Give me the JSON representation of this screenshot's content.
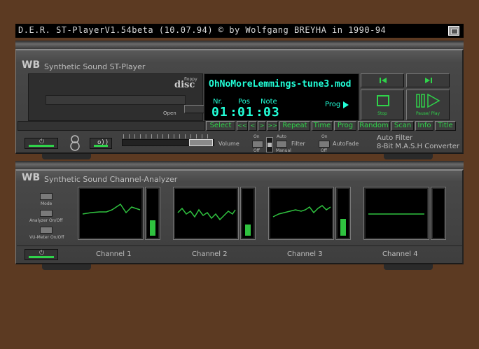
{
  "window": {
    "title": "D.E.R. ST-PlayerV1.54beta (10.07.94)  © by Wolfgang BREYHA in 1990-94"
  },
  "player": {
    "brand": "WB",
    "heading": "Synthetic Sound ST-Player",
    "floppy_label": "floppy",
    "disc_label": "disc",
    "open_label": "Open",
    "display": {
      "module_name": "OhNoMoreLemmings-tune3.mod",
      "nr_label": "Nr.",
      "pos_label": "Pos",
      "note_label": "Note",
      "nr_value": "01",
      "pos_value": "01",
      "note_value": "03",
      "mode_label": "Prog"
    },
    "transport": {
      "stop_label": "Stop",
      "pause_play_label": "Pause/ Play"
    },
    "function_buttons": [
      "Select",
      "<<",
      "<",
      ">",
      ">>",
      "Repeat",
      "Time",
      "Prog",
      "Random",
      "Scan",
      "Info",
      "Title"
    ],
    "controls": {
      "volume_label": "Volume",
      "on_label": "On",
      "off_label": "Off",
      "auto_label": "Auto",
      "manual_label": "Manual",
      "filter_label": "Filter",
      "autofade_label": "AutoFade",
      "on2_label": "On",
      "off2_label": "Off"
    },
    "converter_line1": "Auto Filter",
    "converter_line2": "8-Bit M.A.S.H Converter"
  },
  "analyzer": {
    "brand": "WB",
    "heading": "Synthetic Sound Channel-Analyzer",
    "mode_label": "Mode",
    "analyzer_label": "Analyzer On/Off",
    "vumeter_label": "VU-Meter On/Off",
    "channels": [
      {
        "label": "Channel 1",
        "vu_level": 0.35
      },
      {
        "label": "Channel 2",
        "vu_level": 0.25
      },
      {
        "label": "Channel 3",
        "vu_level": 0.38
      },
      {
        "label": "Channel 4",
        "vu_level": 0.0
      }
    ]
  },
  "colors": {
    "desktop": "#5c3a22",
    "display_text": "#22ffd8",
    "button_text": "#2fd34a",
    "scope_trace": "#2fc23f"
  }
}
